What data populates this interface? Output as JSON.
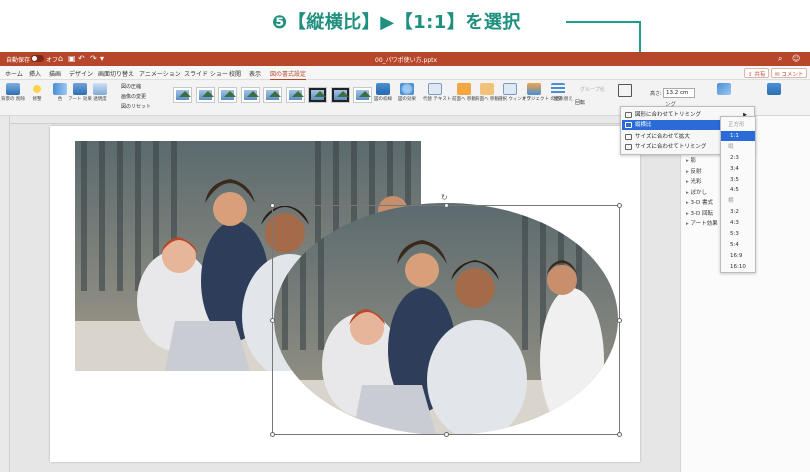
{
  "callout": {
    "text": "❺【縦横比】▶【1:1】を選択"
  },
  "colors": {
    "accent": "#1f9e8c",
    "brand": "#b7472a",
    "menu_selected": "#2b6bd8"
  },
  "titlebar": {
    "autosave": "自動保存",
    "autosave_state": "オフ",
    "document_title": "00_パワポ使い方.pptx"
  },
  "tabs": [
    "ホーム",
    "挿入",
    "描画",
    "デザイン",
    "画面切り替え",
    "アニメーション",
    "スライド ショー",
    "校閲",
    "表示",
    "図の書式設定"
  ],
  "active_tab_index": 9,
  "header_buttons": {
    "share": "共有",
    "comment": "コメント"
  },
  "ribbon": {
    "items": [
      {
        "label": "背景の\n削除",
        "icon": "remove-background-icon"
      },
      {
        "label": "修整",
        "icon": "corrections-icon"
      },
      {
        "label": "色",
        "icon": "color-icon"
      },
      {
        "label": "アート\n効果",
        "icon": "art-effects-icon"
      },
      {
        "label": "透明度",
        "icon": "transparency-icon"
      }
    ],
    "small_items": [
      "図の圧縮",
      "画像の変更",
      "図のリセット"
    ],
    "picture_style_count": 9,
    "right_items": [
      {
        "label": "図の枠線",
        "icon": "picture-border-icon"
      },
      {
        "label": "図の効果",
        "icon": "picture-effects-icon"
      },
      {
        "label": "代替\nテキスト",
        "icon": "alt-text-icon"
      },
      {
        "label": "前面へ\n移動",
        "icon": "bring-forward-icon"
      },
      {
        "label": "背面へ\n移動",
        "icon": "send-backward-icon"
      },
      {
        "label": "選択\nウィンドウ",
        "icon": "selection-pane-icon"
      },
      {
        "label": "オブジェクト\nの並べ替え",
        "icon": "reorder-objects-icon"
      },
      {
        "label": "配置",
        "icon": "align-icon"
      }
    ],
    "group_label": "グループ化",
    "rotate_label": "回転",
    "height_label": "高さ:",
    "height_value": "13.2 cm",
    "far_right": [
      {
        "label": "サイズ",
        "icon": "size-icon"
      },
      {
        "label": "背景として\nプレゼンテーションを作成する",
        "icon": "background-icon"
      }
    ]
  },
  "crop_menu": {
    "items": [
      {
        "label": "図形に合わせてトリミング",
        "has_submenu": true,
        "icon": "crop-shape-icon"
      },
      {
        "label": "縦横比",
        "has_submenu": true,
        "selected": true,
        "icon": "aspect-ratio-icon"
      },
      {
        "label": "サイズに合わせて拡大",
        "has_submenu": false,
        "icon": "fill-icon"
      },
      {
        "label": "サイズに合わせてトリミング",
        "has_submenu": false,
        "icon": "fit-icon"
      }
    ],
    "partial_label": "ング"
  },
  "aspect_submenu": {
    "items": [
      {
        "label": "正方形",
        "header": true
      },
      {
        "label": "1:1",
        "selected": true
      },
      {
        "label": "縦",
        "header": true
      },
      {
        "label": "2:3"
      },
      {
        "label": "3:4"
      },
      {
        "label": "3:5"
      },
      {
        "label": "4:5"
      },
      {
        "label": "横",
        "header": true
      },
      {
        "label": "3:2"
      },
      {
        "label": "4:3"
      },
      {
        "label": "5:3"
      },
      {
        "label": "5:4"
      },
      {
        "label": "16:9"
      },
      {
        "label": "16:10"
      }
    ]
  },
  "format_pane": {
    "items": [
      "影",
      "反射",
      "光彩",
      "ぼかし",
      "3-D 書式",
      "3-D 回転",
      "アート効果"
    ]
  }
}
